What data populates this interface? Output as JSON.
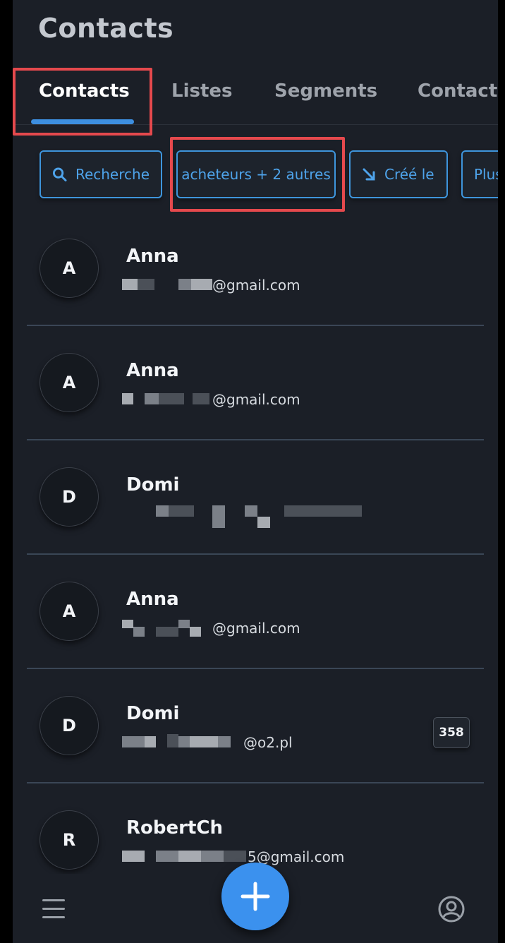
{
  "header": {
    "title": "Contacts"
  },
  "tabs": [
    {
      "label": "Contacts",
      "active": true
    },
    {
      "label": "Listes"
    },
    {
      "label": "Segments"
    },
    {
      "label": "Contacts"
    }
  ],
  "filters": {
    "search_label": "Recherche",
    "selected_filter": "acheteurs + 2 autres",
    "sort_label": "Créé le",
    "more_label": "Plus"
  },
  "contacts": [
    {
      "initial": "A",
      "name": "Anna",
      "email_suffix": "@gmail.com"
    },
    {
      "initial": "A",
      "name": "Anna",
      "email_suffix": "@gmail.com"
    },
    {
      "initial": "D",
      "name": "Domi",
      "email_suffix": ""
    },
    {
      "initial": "A",
      "name": "Anna",
      "email_suffix": "@gmail.com"
    },
    {
      "initial": "D",
      "name": "Domi",
      "email_suffix": "@o2.pl",
      "badge": "358"
    },
    {
      "initial": "R",
      "name": "RobertCh",
      "email_suffix": "5@gmail.com"
    }
  ],
  "bottom_nav": {
    "menu_icon": "hamburger-menu-icon",
    "add_icon": "plus-icon",
    "profile_icon": "user-circle-icon"
  },
  "colors": {
    "accent": "#3d8fe0",
    "highlight": "#e5494d",
    "background": "#1b1f27"
  }
}
